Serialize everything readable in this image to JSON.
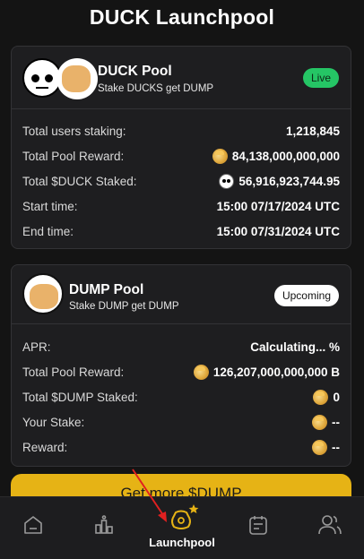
{
  "page": {
    "title": "DUCK Launchpool"
  },
  "duck_pool": {
    "name": "DUCK Pool",
    "subtitle": "Stake DUCKS get DUMP",
    "status": "Live",
    "rows": [
      {
        "label": "Total users staking:",
        "value": "1,218,845",
        "icon": ""
      },
      {
        "label": "Total Pool Reward:",
        "value": "84,138,000,000,000",
        "icon": "dump-coin-icon"
      },
      {
        "label": "Total $DUCK Staked:",
        "value": "56,916,923,744.95",
        "icon": "duck-coin-icon"
      },
      {
        "label": "Start time:",
        "value": "15:00 07/17/2024 UTC",
        "icon": ""
      },
      {
        "label": "End time:",
        "value": "15:00 07/31/2024 UTC",
        "icon": ""
      }
    ]
  },
  "dump_pool": {
    "name": "DUMP Pool",
    "subtitle": "Stake DUMP get DUMP",
    "status": "Upcoming",
    "rows": [
      {
        "label": "APR:",
        "value": "Calculating... %",
        "icon": ""
      },
      {
        "label": "Total Pool Reward:",
        "value": "126,207,000,000,000 B",
        "icon": "dump-coin-icon"
      },
      {
        "label": "Total $DUMP Staked:",
        "value": "0",
        "icon": "dump-coin-icon"
      },
      {
        "label": "Your Stake:",
        "value": "--",
        "icon": "dump-coin-icon"
      },
      {
        "label": "Reward:",
        "value": "--",
        "icon": "dump-coin-icon"
      }
    ]
  },
  "cta": {
    "label": "Get more $DUMP"
  },
  "nav": {
    "items": [
      {
        "icon": "home-icon"
      },
      {
        "icon": "leaderboard-icon"
      },
      {
        "icon": "launchpool-bag-icon",
        "label": "Launchpool",
        "active": true
      },
      {
        "icon": "tasks-icon"
      },
      {
        "icon": "friends-icon"
      }
    ]
  },
  "colors": {
    "accent": "#e6b315",
    "live": "#25c565",
    "card": "#1e1e20",
    "annotation_arrow": "#e02020"
  }
}
